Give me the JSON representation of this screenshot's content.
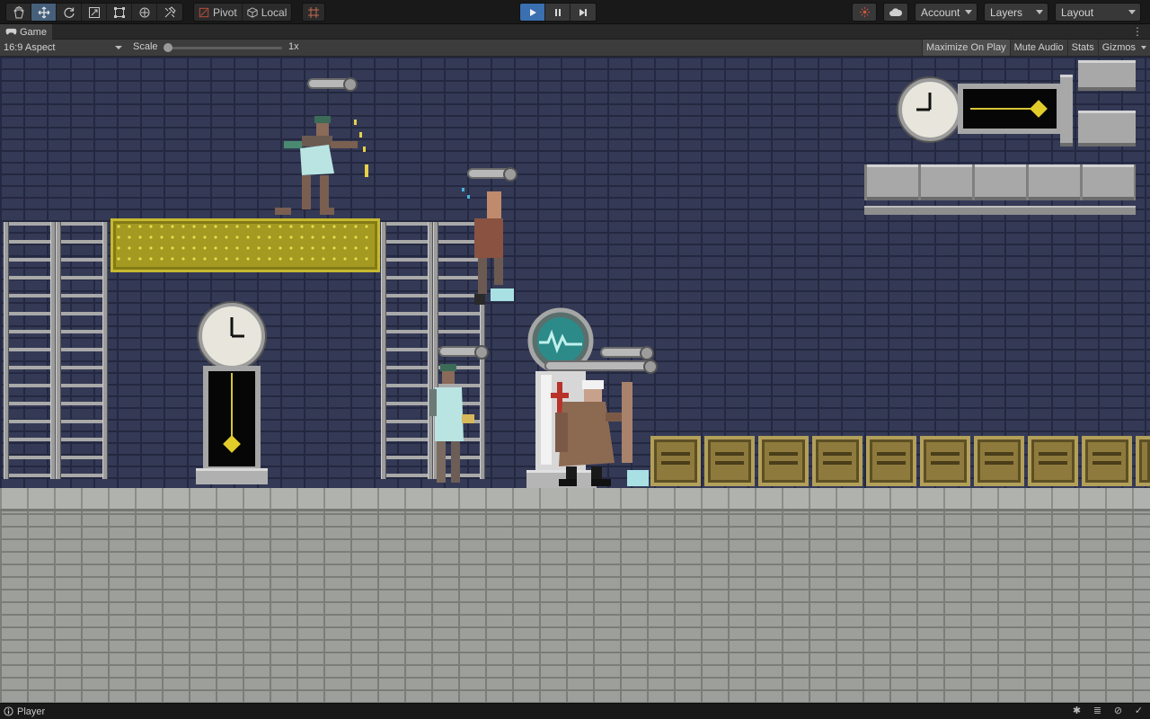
{
  "toolbar": {
    "pivot_label": "Pivot",
    "local_label": "Local",
    "account_label": "Account",
    "layers_label": "Layers",
    "layout_label": "Layout"
  },
  "tab": {
    "title": "Game"
  },
  "gamebar": {
    "aspect_label": "16:9 Aspect",
    "scale_label": "Scale",
    "scale_value": "1x",
    "maximize_label": "Maximize On Play",
    "mute_label": "Mute Audio",
    "stats_label": "Stats",
    "gizmos_label": "Gizmos"
  },
  "status": {
    "text": "Player"
  },
  "colors": {
    "play_active": "#3a6fb0",
    "wall": "#343a56",
    "floor": "#9da09a",
    "gold_panel": "#a49a22",
    "crate": "#8e7a3c"
  },
  "icons": {
    "tools": [
      "hand-icon",
      "move-icon",
      "rotate-icon",
      "scale-icon",
      "rect-icon",
      "transform-icon",
      "custom-tool-icon"
    ],
    "grid_snap": "grid-snap-icon",
    "play": "play-icon",
    "pause": "pause-icon",
    "step": "step-icon",
    "collab": "collab-icon",
    "cloud": "cloud-icon"
  }
}
